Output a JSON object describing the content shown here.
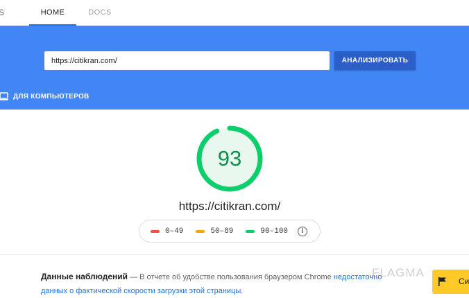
{
  "nav": {
    "cut_tab": "S",
    "tabs": [
      {
        "label": "HOME",
        "active": true
      },
      {
        "label": "DOCS",
        "active": false
      }
    ]
  },
  "search": {
    "url_value": "https://citikran.com/",
    "analyze_label": "АНАЛИЗИРОВАТЬ"
  },
  "device_tab": {
    "label": "ДЛЯ КОМПЬЮТЕРОВ",
    "icon": "laptop-icon"
  },
  "result": {
    "score": 93,
    "score_max": 100,
    "url": "https://citikran.com/",
    "score_color": "#0cce6b"
  },
  "legend": {
    "items": [
      {
        "label": "0–49",
        "color": "#ff4e42"
      },
      {
        "label": "50–89",
        "color": "#ffa400"
      },
      {
        "label": "90–100",
        "color": "#0cce6b"
      }
    ],
    "info_icon": "info-icon"
  },
  "field_data": {
    "title": "Данные наблюдений",
    "text": " — В отчете об удобстве пользования браузером Chrome ",
    "link_part1": "недостаточно",
    "link_part2": "данных о фактической скорости загрузки этой страницы",
    "end": "."
  },
  "watermark": "FLAGMA",
  "promo": {
    "label": "Си",
    "icon": "flag-icon"
  },
  "colors": {
    "hero": "#4285f4",
    "button": "#2b5ec9",
    "link": "#1a73e8"
  }
}
